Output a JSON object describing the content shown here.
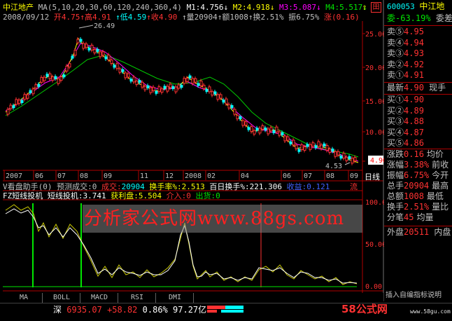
{
  "colors": {
    "bg": "#000000",
    "up": "#ff3232",
    "down": "#00e600",
    "axis": "#b00000",
    "price_line": "#00ffff",
    "ma_yellow": "#ffff00",
    "ma_magenta": "#ff00ff",
    "ma_green": "#00c800"
  },
  "header": {
    "stock_name": "中江地产",
    "ma_params": "MA(5,10,20,30,60,120,240,360,4)",
    "m1": "M1:4.756↓",
    "m2": "M2:4.918↓",
    "m3": "M3:5.087↓",
    "m4": "M4:5.517↓",
    "date": "2008/09/12",
    "open": "开4.75",
    "high": "↑高4.91",
    "low": "↑低4.59",
    "close": "↑收4.90",
    "volume": "↑量20904",
    "amount": "↑额1008",
    "turnover": "↑换2.51%",
    "amplitude": "振6.75%",
    "change": "涨(0.16)"
  },
  "top_icons": {
    "up": "⇧",
    "grid": "田"
  },
  "price_axis": {
    "ticks": [
      "25.00",
      "20.00",
      "15.00",
      "10.00",
      "5.00"
    ],
    "current": "4.90"
  },
  "annotations": {
    "high": "26.49",
    "low": "4.53"
  },
  "date_axis": {
    "labels": [
      "2007",
      "06",
      "07",
      "08",
      "09",
      "11",
      "12",
      "2008",
      "02",
      "04",
      "06",
      "07",
      "08",
      "09"
    ],
    "period": "日线"
  },
  "indicator1": {
    "title": "V看盘助手(0) 预测成交:0",
    "vol_label": "成交:",
    "vol_value": "20904",
    "turnover_label": "换手率%:",
    "turnover_value": "2.513",
    "hundred_label": "百日换手%:",
    "hundred_value": "221.306",
    "return_label": "收益:",
    "return_value": "0.121",
    "flow": "流"
  },
  "indicator2": {
    "title": "FZ短线投机",
    "short_label": "短线投机:",
    "short_value": "3.741",
    "profit_label": "获利盘:",
    "profit_value": "5.504",
    "enter": "介入:0",
    "exit": "出货:0",
    "ticks": [
      "100.00",
      "50.00",
      "0.00"
    ]
  },
  "watermark": "分析家公式网www.88gs.com",
  "tabs": [
    "MA",
    "BOLL",
    "MACD",
    "RSI",
    "DMI"
  ],
  "status": {
    "index_name": "深",
    "index_value": "6935.07",
    "index_change": "+58.82",
    "index_pct": "0.86%",
    "index_amount": "97.27亿"
  },
  "brand": {
    "text": "58公式网",
    "url": "www.58gu.com"
  },
  "right_panel": {
    "code": "600053",
    "name": "中江地",
    "ratio": "委-63.19%",
    "ratio_tail": "委差",
    "sells": [
      {
        "label": "卖⑤",
        "price": "4.95"
      },
      {
        "label": "卖④",
        "price": "4.94"
      },
      {
        "label": "卖③",
        "price": "4.93"
      },
      {
        "label": "卖②",
        "price": "4.92"
      },
      {
        "label": "卖①",
        "price": "4.91"
      }
    ],
    "latest_label": "最新",
    "latest_price": "4.90",
    "latest_tail": "现手",
    "buys": [
      {
        "label": "买①",
        "price": "4.90"
      },
      {
        "label": "买②",
        "price": "4.89"
      },
      {
        "label": "买③",
        "price": "4.88"
      },
      {
        "label": "买④",
        "price": "4.87"
      },
      {
        "label": "买⑤",
        "price": "4.86"
      }
    ],
    "stats": [
      {
        "label": "涨跌",
        "value": "0.16",
        "tail": "均价"
      },
      {
        "label": "涨幅",
        "value": "3.38%",
        "tail": "前收"
      },
      {
        "label": "振幅",
        "value": "6.75%",
        "tail": "今开"
      },
      {
        "label": "总手",
        "value": "20904",
        "tail": "最高"
      },
      {
        "label": "总额",
        "value": "1008",
        "tail": "最低"
      },
      {
        "label": "换手",
        "value": "2.51%",
        "tail": "量比"
      },
      {
        "label": "分笔",
        "value": "45",
        "tail": "均量"
      }
    ],
    "outer_label": "外盘",
    "outer_value": "20511",
    "inner_label": "内盘",
    "bottom_text": "插入自编指标说明"
  }
}
